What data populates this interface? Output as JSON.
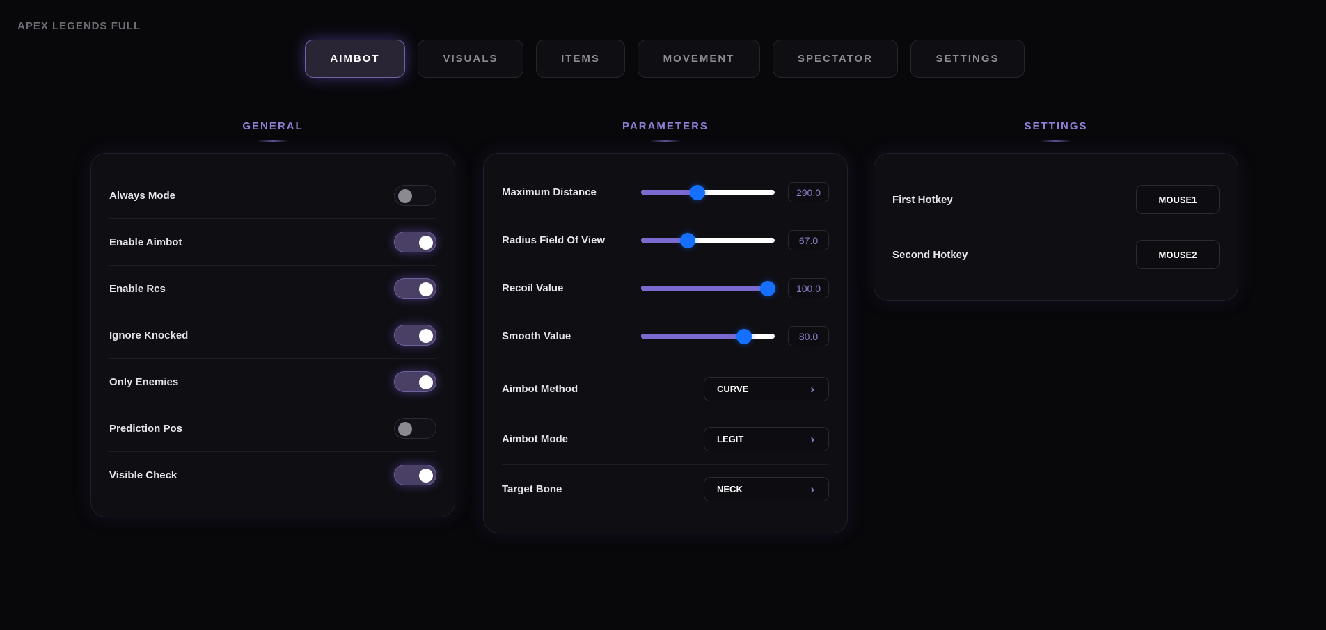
{
  "app": {
    "title": "APEX LEGENDS FULL"
  },
  "tabs": [
    {
      "label": "AIMBOT",
      "active": true
    },
    {
      "label": "VISUALS",
      "active": false
    },
    {
      "label": "ITEMS",
      "active": false
    },
    {
      "label": "MOVEMENT",
      "active": false
    },
    {
      "label": "SPECTATOR",
      "active": false
    },
    {
      "label": "SETTINGS",
      "active": false
    }
  ],
  "general": {
    "title": "GENERAL",
    "toggles": [
      {
        "label": "Always Mode",
        "on": false
      },
      {
        "label": "Enable Aimbot",
        "on": true
      },
      {
        "label": "Enable Rcs",
        "on": true
      },
      {
        "label": "Ignore Knocked",
        "on": true
      },
      {
        "label": "Only Enemies",
        "on": true
      },
      {
        "label": "Prediction Pos",
        "on": false
      },
      {
        "label": "Visible Check",
        "on": true
      }
    ]
  },
  "parameters": {
    "title": "PARAMETERS",
    "sliders": [
      {
        "label": "Maximum Distance",
        "value": "290.0",
        "fraction": 0.42
      },
      {
        "label": "Radius Field Of View",
        "value": "67.0",
        "fraction": 0.35
      },
      {
        "label": "Recoil Value",
        "value": "100.0",
        "fraction": 0.95
      },
      {
        "label": "Smooth Value",
        "value": "80.0",
        "fraction": 0.77
      }
    ],
    "selects": [
      {
        "label": "Aimbot Method",
        "value": "CURVE"
      },
      {
        "label": "Aimbot Mode",
        "value": "LEGIT"
      },
      {
        "label": "Target Bone",
        "value": "NECK"
      }
    ],
    "chevron": "›"
  },
  "settings": {
    "title": "SETTINGS",
    "hotkeys": [
      {
        "label": "First Hotkey",
        "value": "MOUSE1"
      },
      {
        "label": "Second Hotkey",
        "value": "MOUSE2"
      }
    ]
  },
  "colors": {
    "accent": "#8f7fd4",
    "toggle_on": "#4a4066",
    "slider_fill": "#7b6bd0",
    "slider_thumb": "#1670ff"
  }
}
